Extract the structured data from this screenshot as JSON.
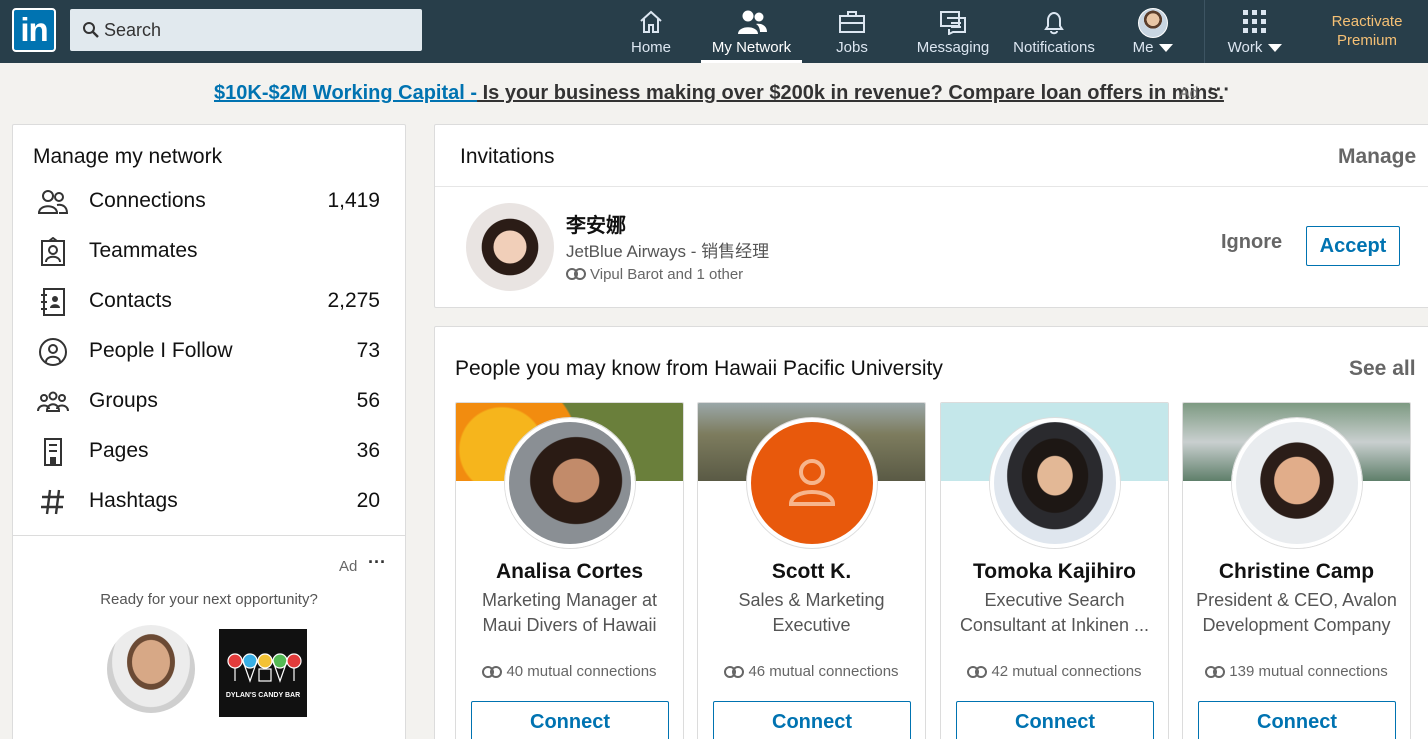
{
  "nav": {
    "logo": "in",
    "search_placeholder": "Search",
    "items": [
      {
        "label": "Home",
        "icon": "home-icon"
      },
      {
        "label": "My Network",
        "icon": "network-icon"
      },
      {
        "label": "Jobs",
        "icon": "briefcase-icon"
      },
      {
        "label": "Messaging",
        "icon": "messaging-icon"
      },
      {
        "label": "Notifications",
        "icon": "bell-icon"
      },
      {
        "label": "Me",
        "icon": "avatar"
      },
      {
        "label": "Work",
        "icon": "grid-icon"
      }
    ],
    "active": "My Network",
    "premium_line1": "Reactivate",
    "premium_line2": "Premium"
  },
  "ad_banner": {
    "link_text": "$10K-$2M Working Capital -",
    "rest_text": " Is your business making over $200k in revenue? Compare loan offers in mins.",
    "ad_label": "Ad",
    "menu": "···"
  },
  "manage_network": {
    "title": "Manage my network",
    "items": [
      {
        "label": "Connections",
        "count": "1,419",
        "icon": "connections-icon"
      },
      {
        "label": "Teammates",
        "count": "",
        "icon": "teammates-icon"
      },
      {
        "label": "Contacts",
        "count": "2,275",
        "icon": "contacts-icon"
      },
      {
        "label": "People I Follow",
        "count": "73",
        "icon": "follow-icon"
      },
      {
        "label": "Groups",
        "count": "56",
        "icon": "groups-icon"
      },
      {
        "label": "Pages",
        "count": "36",
        "icon": "pages-icon"
      },
      {
        "label": "Hashtags",
        "count": "20",
        "icon": "hashtag-icon"
      }
    ],
    "ad_label": "Ad",
    "ad_menu": "···",
    "ad_text": "Ready for your next opportunity?",
    "candy_text": "DYLAN'S CANDY BAR"
  },
  "invitations": {
    "title": "Invitations",
    "manage": "Manage",
    "invite": {
      "name": "李安娜",
      "headline": "JetBlue Airways - 销售经理",
      "mutual": "Vipul Barot and 1 other"
    },
    "ignore": "Ignore",
    "accept": "Accept"
  },
  "pymk": {
    "title": "People you may know from Hawaii Pacific University",
    "see_all": "See all",
    "people": [
      {
        "name": "Analisa Cortes",
        "headline": "Marketing Manager at Maui Divers of Hawaii",
        "mutual": "40 mutual connections",
        "button": "Connect"
      },
      {
        "name": "Scott K.",
        "headline": "Sales & Marketing Executive",
        "mutual": "46 mutual connections",
        "button": "Connect"
      },
      {
        "name": "Tomoka Kajihiro",
        "headline": "Executive Search Consultant at Inkinen ...",
        "mutual": "42 mutual connections",
        "button": "Connect"
      },
      {
        "name": "Christine Camp",
        "headline": "President & CEO, Avalon Development Company",
        "mutual": "139 mutual connections",
        "button": "Connect"
      }
    ]
  },
  "colors": {
    "nav_bg": "#283e4a",
    "brand_blue": "#0073b1",
    "premium": "#f5c075",
    "page_bg": "#f3f2ef"
  }
}
